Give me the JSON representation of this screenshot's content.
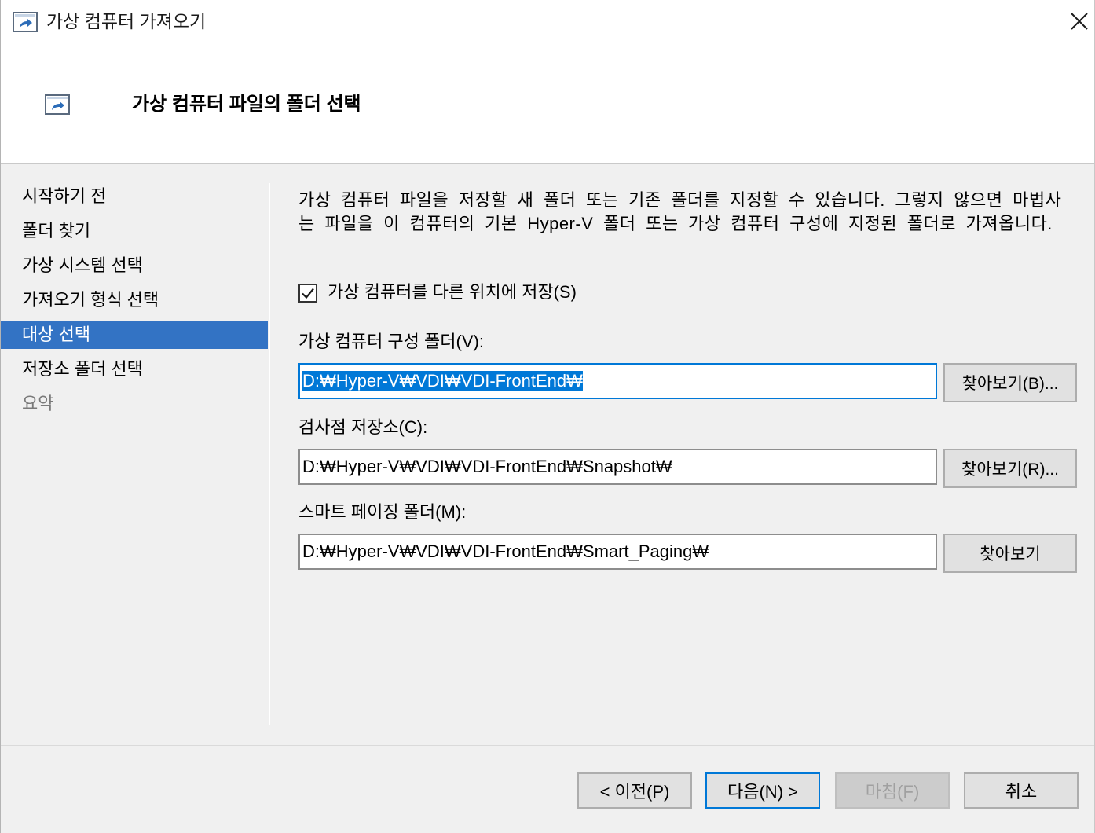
{
  "window": {
    "title": "가상 컴퓨터 가져오기",
    "icon": "import-vm-icon",
    "close_icon": "close-icon"
  },
  "header": {
    "title": "가상 컴퓨터 파일의 폴더 선택",
    "icon": "import-vm-icon"
  },
  "nav": {
    "items": [
      {
        "label": "시작하기 전",
        "selected": false,
        "enabled": true
      },
      {
        "label": "폴더 찾기",
        "selected": false,
        "enabled": true
      },
      {
        "label": "가상 시스템 선택",
        "selected": false,
        "enabled": true
      },
      {
        "label": "가져오기 형식 선택",
        "selected": false,
        "enabled": true
      },
      {
        "label": "대상 선택",
        "selected": true,
        "enabled": true
      },
      {
        "label": "저장소 폴더 선택",
        "selected": false,
        "enabled": true
      },
      {
        "label": "요약",
        "selected": false,
        "enabled": false
      }
    ]
  },
  "content": {
    "description": "가상 컴퓨터 파일을 저장할 새 폴더 또는 기존 폴더를 지정할 수 있습니다. 그렇지 않으면 마법사는 파일을 이 컴퓨터의 기본 Hyper-V 폴더 또는 가상 컴퓨터 구성에 지정된 폴더로 가져옵니다.",
    "store_elsewhere": {
      "label": "가상 컴퓨터를 다른 위치에 저장(S)",
      "checked": true,
      "check_icon": "check-icon"
    },
    "fields": [
      {
        "label": "가상 컴퓨터 구성 폴더(V):",
        "value": "D:₩Hyper-V₩VDI₩VDI-FrontEnd₩",
        "focused": true,
        "text_selected": true,
        "browse_label": "찾아보기(B)..."
      },
      {
        "label": "검사점 저장소(C):",
        "value": "D:₩Hyper-V₩VDI₩VDI-FrontEnd₩Snapshot₩",
        "focused": false,
        "text_selected": false,
        "browse_label": "찾아보기(R)..."
      },
      {
        "label": "스마트 페이징 폴더(M):",
        "value": "D:₩Hyper-V₩VDI₩VDI-FrontEnd₩Smart_Paging₩",
        "focused": false,
        "text_selected": false,
        "browse_label": "찾아보기"
      }
    ]
  },
  "footer": {
    "buttons": [
      {
        "label": "< 이전(P)",
        "enabled": true,
        "default": false
      },
      {
        "label": "다음(N) >",
        "enabled": true,
        "default": true
      },
      {
        "label": "마침(F)",
        "enabled": false,
        "default": false
      },
      {
        "label": "취소",
        "enabled": true,
        "default": false
      }
    ]
  },
  "colors": {
    "accent": "#0078D7",
    "nav_selected": "#3373C4",
    "disabled_text": "#A0A0A0"
  }
}
